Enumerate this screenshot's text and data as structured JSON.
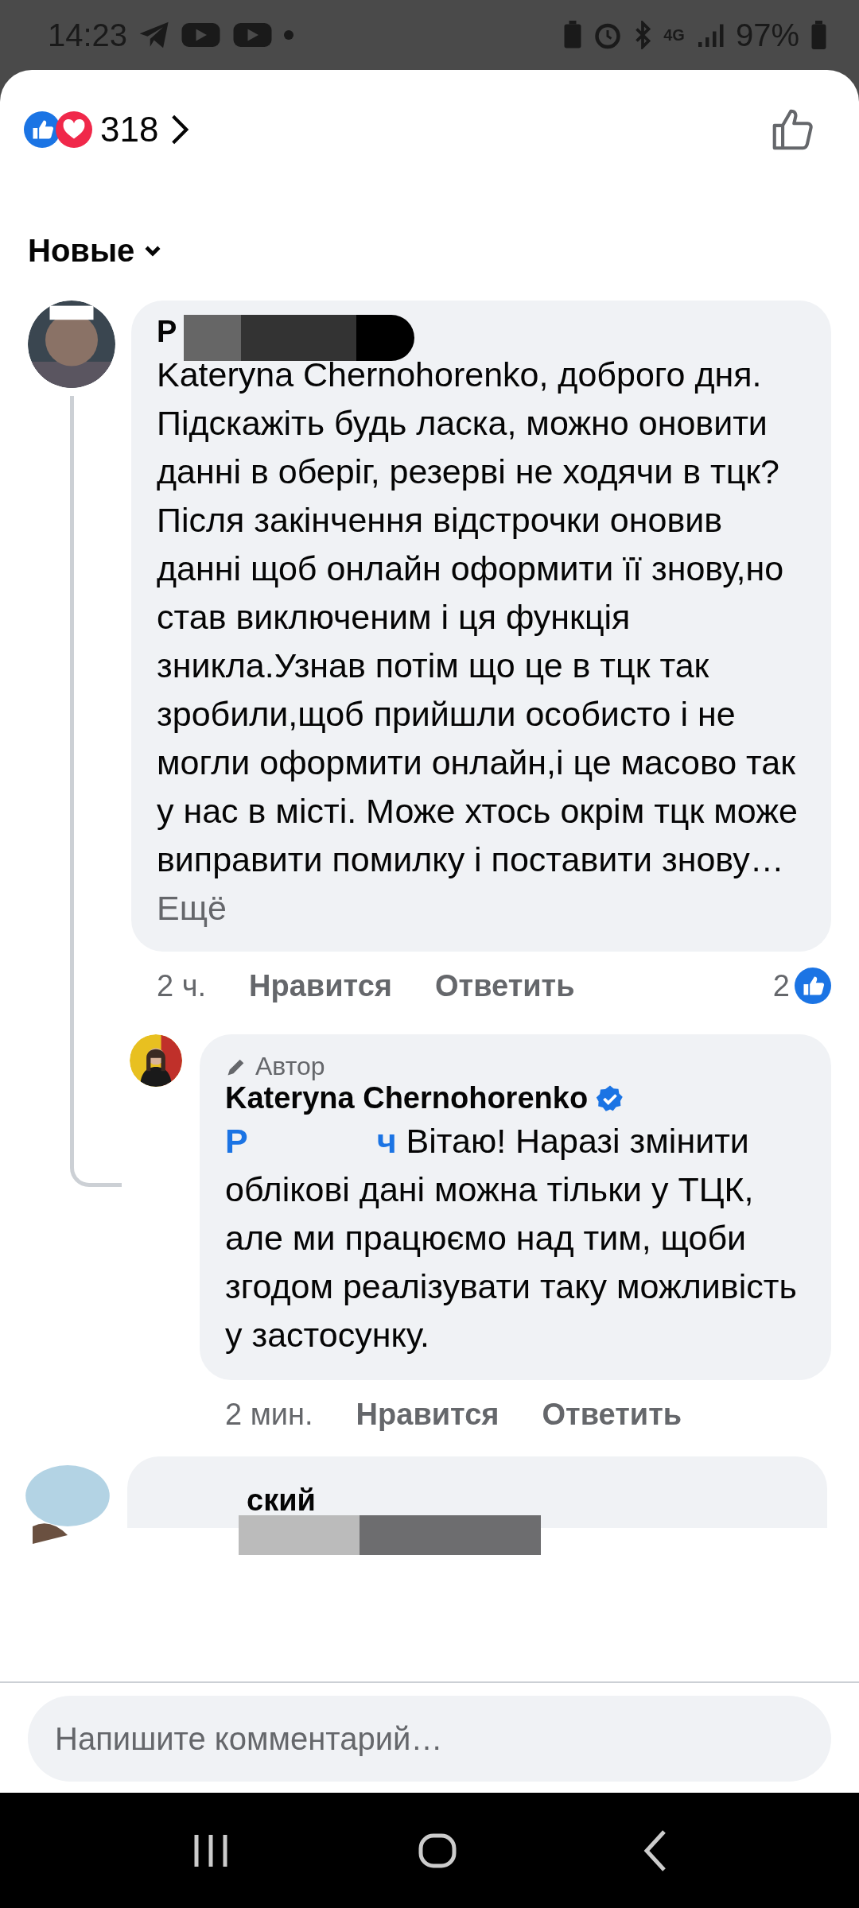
{
  "status_bar": {
    "time": "14:23",
    "battery": "97%",
    "network": "4G"
  },
  "reactions": {
    "count": "318"
  },
  "sort": {
    "label": "Новые"
  },
  "comments": [
    {
      "author": "P",
      "redacted": true,
      "text": "Kateryna Chernohorenko, доброго дня. Підскажіть будь ласка, можно оновити данні в оберіг, резерві не ходячи в тцк? Після закінчення відстрочки оновив данні щоб онлайн оформити її знову,но став виключеним і ця функція зникла.Узнав потім що це в тцк так зробили,щоб прийшли особисто і не могли оформити онлайн,і це масово так у нас в місті. Може хтось окрім тцк може виправити помилку і поставити знову…",
      "see_more": "Ещё",
      "time": "2 ч.",
      "like": "Нравится",
      "reply": "Ответить",
      "like_count": "2",
      "replies": [
        {
          "badge": "Автор",
          "author": "Kateryna Chernohorenko",
          "verified": true,
          "mention": "Р ч",
          "text": "Вітаю! Наразі змінити облікові дані можна тільки у ТЦК, але ми працюємо над тим, щоби згодом реалізувати таку можливість у застосунку.",
          "time": "2 мин.",
          "like": "Нравится",
          "reply": "Ответить"
        }
      ]
    },
    {
      "author": "ский",
      "redacted": true
    }
  ],
  "composer": {
    "placeholder": "Напишите комментарий…"
  }
}
